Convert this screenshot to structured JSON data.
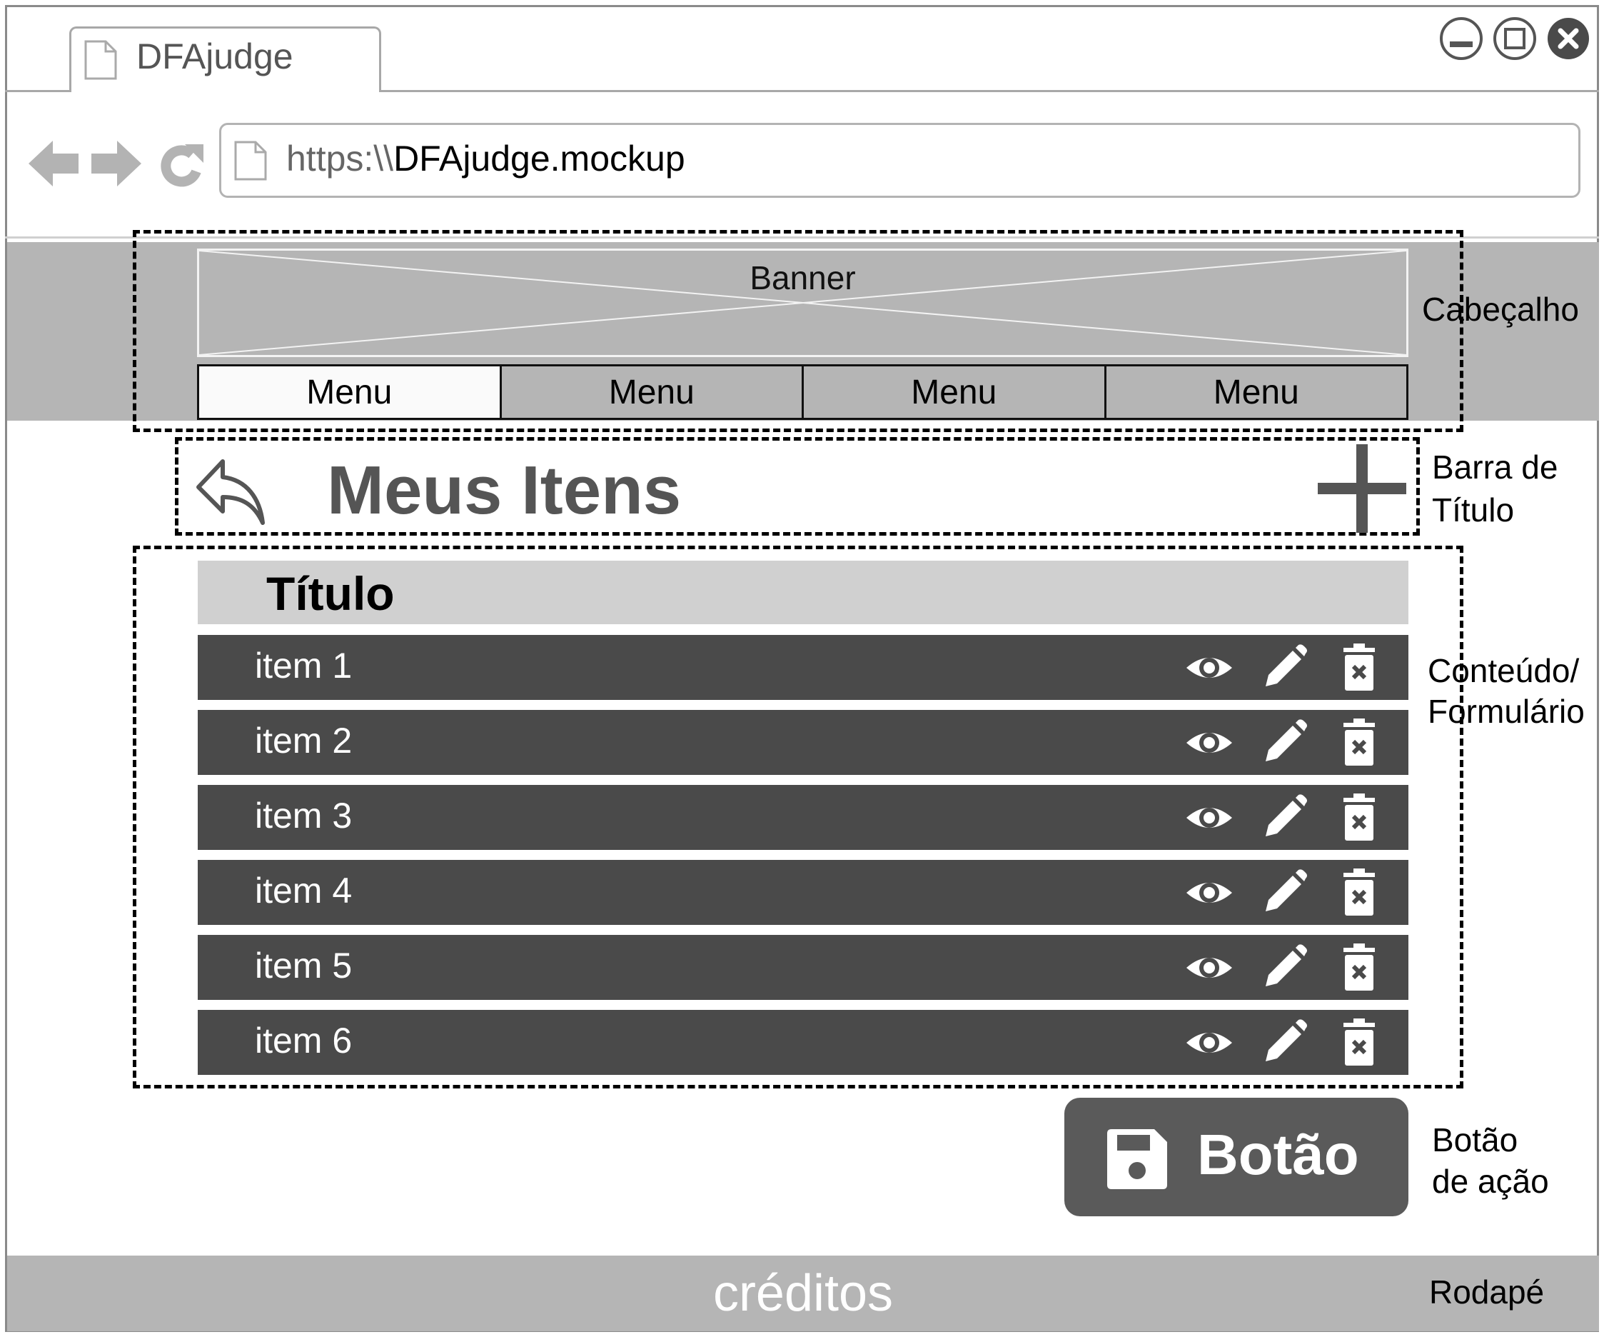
{
  "browser": {
    "tab_title": "DFAjudge",
    "url_scheme": "https:\\\\",
    "url_host": "DFAjudge.mockup"
  },
  "header": {
    "banner_label": "Banner",
    "menu": [
      "Menu",
      "Menu",
      "Menu",
      "Menu"
    ]
  },
  "title_bar": {
    "title": "Meus Itens"
  },
  "content": {
    "list_title": "Título",
    "items": [
      "item 1",
      "item 2",
      "item 3",
      "item 4",
      "item 5",
      "item 6"
    ],
    "row_actions": [
      "eye-icon",
      "pencil-icon",
      "trash-icon"
    ]
  },
  "action": {
    "button_label": "Botão",
    "icon": "floppy-disk-icon"
  },
  "footer": {
    "text": "créditos"
  },
  "annotations": {
    "header": "Cabeçalho",
    "title_bar_line1": "Barra de",
    "title_bar_line2": "Título",
    "content_line1": "Conteúdo/",
    "content_line2": "Formulário",
    "action_line1": "Botão",
    "action_line2": "de ação",
    "footer": "Rodapé"
  },
  "colors": {
    "header_band": "#b5b5b5",
    "row_background": "#4a4a4a",
    "list_header": "#d0d0d0",
    "action_button": "#5a5a5a"
  }
}
